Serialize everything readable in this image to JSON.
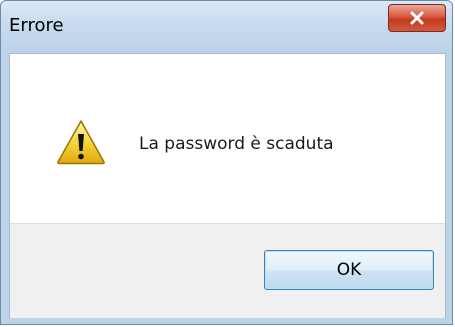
{
  "window": {
    "title": "Errore"
  },
  "titlebar": {
    "close_icon": "close-icon"
  },
  "dialog": {
    "icon": "warning-icon",
    "message": "La password è scaduta"
  },
  "buttons": {
    "ok_label": "OK"
  },
  "colors": {
    "titlebar": "#bcd3ea",
    "close_button": "#c94a2e",
    "button_bar": "#f0f0f0",
    "ok_border": "#3c7fb1"
  }
}
